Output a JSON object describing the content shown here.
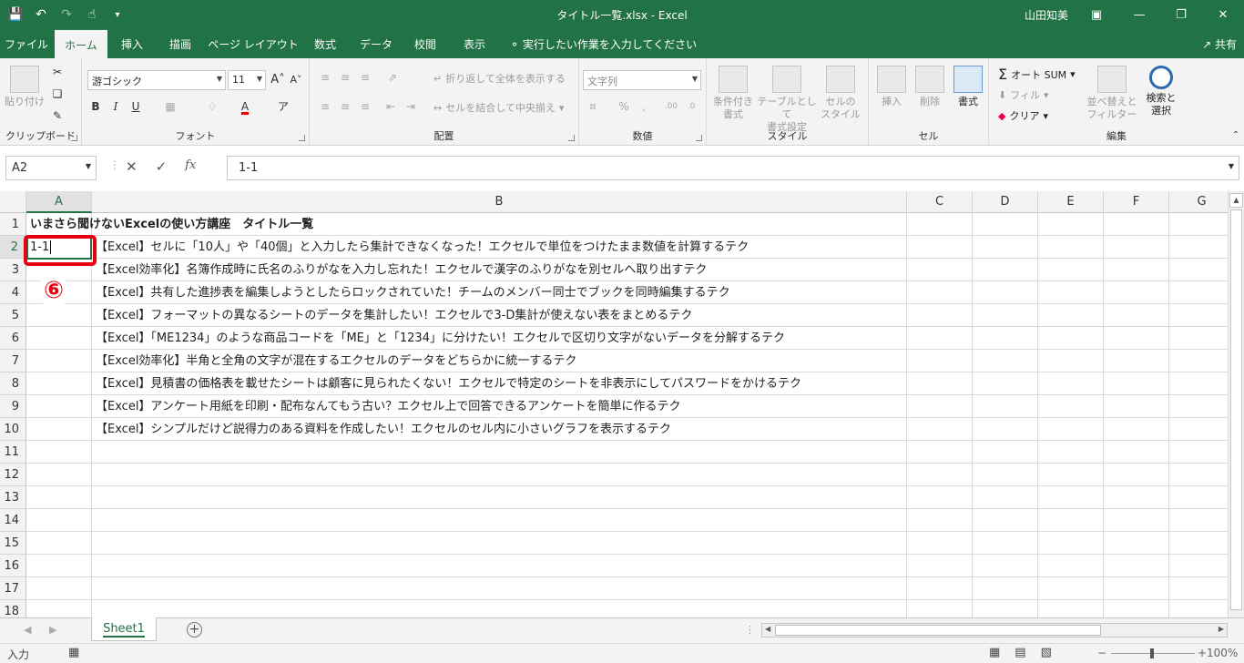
{
  "titlebar": {
    "doc_title": "タイトル一覧.xlsx  -  Excel",
    "user": "山田知美",
    "qat_icons": [
      "save-icon",
      "undo-icon",
      "redo-icon",
      "touch-mode-icon",
      "customize-icon"
    ]
  },
  "tabs": [
    {
      "label": "ファイル"
    },
    {
      "label": "ホーム"
    },
    {
      "label": "挿入"
    },
    {
      "label": "描画"
    },
    {
      "label": "ページ レイアウト"
    },
    {
      "label": "数式"
    },
    {
      "label": "データ"
    },
    {
      "label": "校閲"
    },
    {
      "label": "表示"
    }
  ],
  "tellme": "実行したい作業を入力してください",
  "share": "共有",
  "ribbon": {
    "clipboard": {
      "label": "クリップボード",
      "paste": "貼り付け"
    },
    "font": {
      "label": "フォント",
      "font_name": "游ゴシック",
      "font_size": "11"
    },
    "alignment": {
      "label": "配置",
      "wrap": "折り返して全体を表示する",
      "merge": "セルを結合して中央揃え"
    },
    "number": {
      "label": "数値",
      "format": "文字列"
    },
    "styles": {
      "label": "スタイル",
      "conditional": "条件付き\n書式",
      "table": "テーブルとして\n書式設定",
      "cellstyle": "セルの\nスタイル"
    },
    "cells": {
      "label": "セル",
      "insert": "挿入",
      "delete": "削除",
      "format": "書式"
    },
    "editing": {
      "label": "編集",
      "autosum": "オート SUM",
      "fill": "フィル",
      "clear": "クリア",
      "sort": "並べ替えと\nフィルター",
      "find": "検索と\n選択"
    }
  },
  "formula_bar": {
    "name_box": "A2",
    "formula": "1-1"
  },
  "columns": [
    "A",
    "B",
    "C",
    "D",
    "E",
    "F",
    "G"
  ],
  "rows": [
    1,
    2,
    3,
    4,
    5,
    6,
    7,
    8,
    9,
    10,
    11,
    12,
    13,
    14,
    15,
    16,
    17,
    18
  ],
  "cells": {
    "A1": "いまさら聞けないExcelの使い方講座　タイトル一覧",
    "A2": "1-1",
    "B2": "【Excel】セルに「10人」や「40個」と入力したら集計できなくなった！エクセルで単位をつけたまま数値を計算するテク",
    "B3": "【Excel効率化】名簿作成時に氏名のふりがなを入力し忘れた！エクセルで漢字のふりがなを別セルへ取り出すテク",
    "B4": "【Excel】共有した進捗表を編集しようとしたらロックされていた！チームのメンバー同士でブックを同時編集するテク",
    "B5": "【Excel】フォーマットの異なるシートのデータを集計したい！エクセルで3-D集計が使えない表をまとめるテク",
    "B6": "【Excel】「ME1234」のような商品コードを「ME」と「1234」に分けたい！エクセルで区切り文字がないデータを分解するテク",
    "B7": "【Excel効率化】半角と全角の文字が混在するエクセルのデータをどちらかに統一するテク",
    "B8": "【Excel】見積書の価格表を載せたシートは顧客に見られたくない！エクセルで特定のシートを非表示にしてパスワードをかけるテク",
    "B9": "【Excel】アンケート用紙を印刷・配布なんてもう古い？エクセル上で回答できるアンケートを簡単に作るテク",
    "B10": "【Excel】シンプルだけど説得力のある資料を作成したい！エクセルのセル内に小さいグラフを表示するテク"
  },
  "annotation": {
    "number": "⑥",
    "color": "#e60012"
  },
  "sheet_tab": "Sheet1",
  "status": {
    "mode": "入力",
    "zoom": "100%"
  },
  "colors": {
    "accent": "#217346",
    "annotation": "#e60012"
  }
}
